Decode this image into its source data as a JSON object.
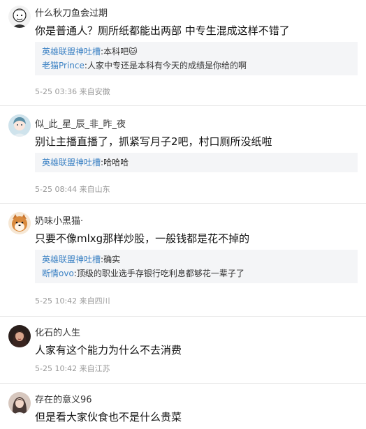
{
  "comments": [
    {
      "avatar": "avatar-cartoon-man",
      "username": "什么秋刀鱼会过期",
      "text": "你是普通人？厕所纸都能出两部 中专生混成这样不错了",
      "replies": [
        {
          "user": "英雄联盟神吐槽",
          "body": "本科吧🐱"
        },
        {
          "user": "老猫Prince",
          "body": "人家中专还是本科有今天的成绩是你给的啊"
        }
      ],
      "time": "5-25 03:36",
      "location": "来自安徽"
    },
    {
      "avatar": "avatar-anime-girl",
      "username": "似_此_星_辰_非_昨_夜",
      "text": "别让主播直播了，抓紧写月子2吧，村口厕所没纸啦",
      "replies": [
        {
          "user": "英雄联盟神吐槽",
          "body": "哈哈哈"
        }
      ],
      "time": "5-25 08:44",
      "location": "来自山东"
    },
    {
      "avatar": "avatar-shiba-dog",
      "username": "奶味小黑猫·",
      "text": "只要不像mlxg那样炒股，一般钱都是花不掉的",
      "replies": [
        {
          "user": "英雄联盟神吐槽",
          "body": "确实"
        },
        {
          "user": "断情ovo",
          "body": "顶级的职业选手存银行吃利息都够花一辈子了"
        }
      ],
      "time": "5-25 10:42",
      "location": "来自四川"
    },
    {
      "avatar": "avatar-woman-dark",
      "username": "化石的人生",
      "text": "人家有这个能力为什么不去消费",
      "replies": [],
      "time": "5-25 10:42",
      "location": "来自江苏"
    },
    {
      "avatar": "avatar-girl-portrait",
      "username": "存在的意义96",
      "text": "但是看大家伙食也不是什么贵菜",
      "replies": [],
      "time": "",
      "location": ""
    }
  ],
  "colors": {
    "reply_user": "#3c82c4",
    "reply_bg": "#f4f5f7",
    "meta": "#999999",
    "divider": "#e8e8e8"
  }
}
